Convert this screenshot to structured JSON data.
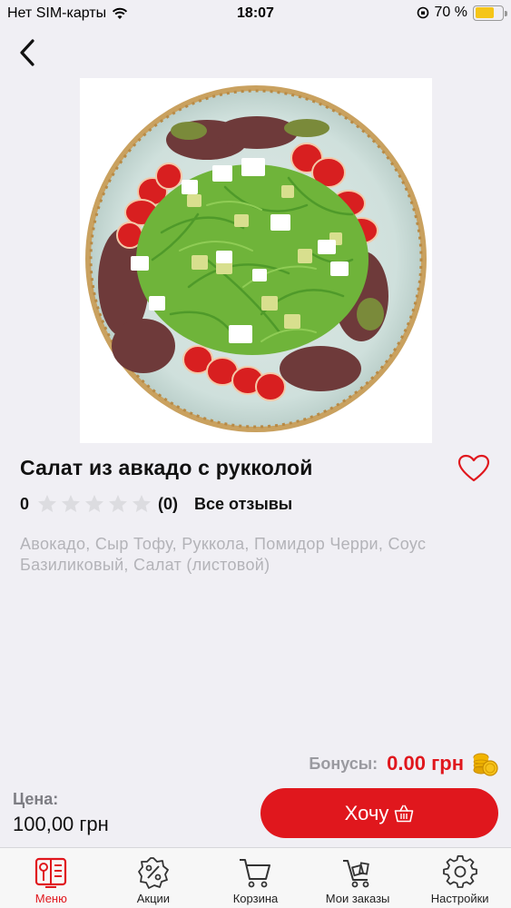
{
  "status_bar": {
    "carrier": "Нет SIM-карты",
    "time": "18:07",
    "battery_percent": "70 %",
    "battery_level": 0.7
  },
  "product": {
    "title": "Салат из авкадо с рукколой",
    "rating": "0",
    "stars_filled": 0,
    "stars_total": 5,
    "review_count": "(0)",
    "all_reviews": "Все отзывы",
    "ingredients": "Авокадо, Сыр Тофу, Руккола, Помидор Черри, Соус Базиликовый, Салат (листовой)"
  },
  "bonus": {
    "label": "Бонусы:",
    "value": "0.00 грн"
  },
  "price": {
    "label": "Цена:",
    "value": "100,00 грн"
  },
  "actions": {
    "want_label": "Хочу"
  },
  "tabs": [
    {
      "label": "Меню",
      "icon": "menu-book-icon",
      "active": true
    },
    {
      "label": "Акции",
      "icon": "discount-badge-icon",
      "active": false
    },
    {
      "label": "Корзина",
      "icon": "cart-icon",
      "active": false
    },
    {
      "label": "Мои заказы",
      "icon": "orders-cart-icon",
      "active": false
    },
    {
      "label": "Настройки",
      "icon": "gear-icon",
      "active": false
    }
  ],
  "colors": {
    "accent": "#e0171d",
    "background": "#f0eff4",
    "muted_text": "#b3b3b8"
  }
}
